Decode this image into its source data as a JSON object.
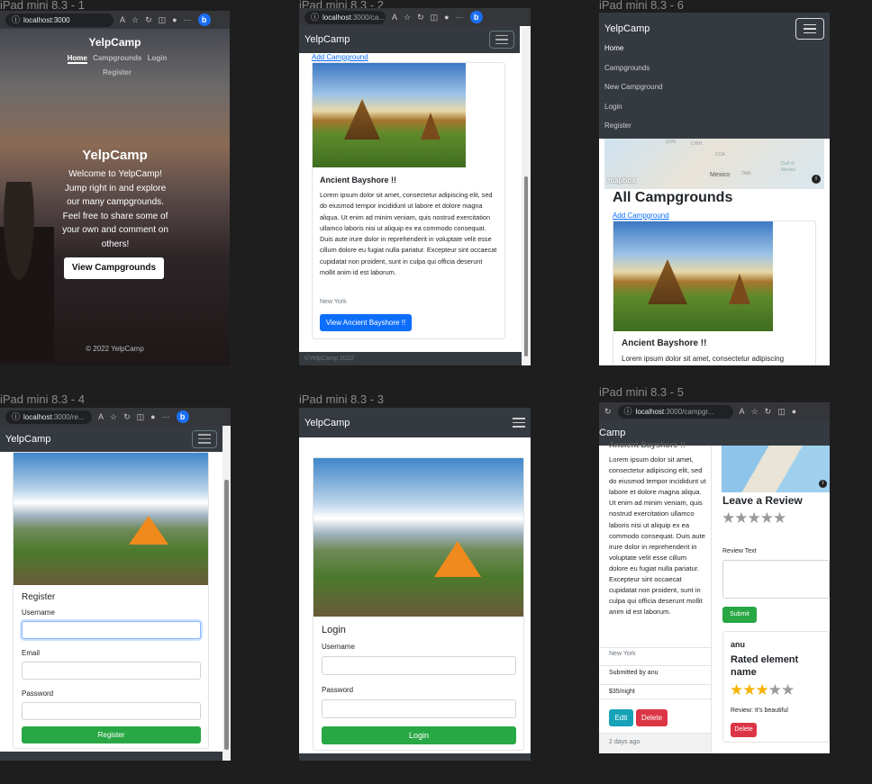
{
  "frames": [
    {
      "label": "iPad mini 8.3 - 1"
    },
    {
      "label": "iPad mini 8.3 - 2"
    },
    {
      "label": "iPad mini 8.3 - 6"
    },
    {
      "label": "iPad mini 8.3 - 4"
    },
    {
      "label": "iPad mini 8.3 - 3"
    },
    {
      "label": "iPad mini 8.3 - 5"
    }
  ],
  "browser": {
    "url_home": "localhost:3000",
    "url_campgrounds_prefix": "localhost",
    "url_campgrounds_rest": ":3000/ca...",
    "url_register_prefix": "localhost",
    "url_register_rest": ":3000/re...",
    "url_show_prefix": "localhost",
    "url_show_rest": ":3000/campgr...",
    "read_aloud": "A",
    "more": "···"
  },
  "brand": "YelpCamp",
  "brand_cut": "Camp",
  "home": {
    "nav": [
      "Home",
      "Campgrounds",
      "Login",
      "Register"
    ],
    "title": "YelpCamp",
    "lead": "Welcome to YelpCamp! Jump right in and explore our many campgrounds. Feel free to share some of your own and comment on others!",
    "cta": "View Campgrounds",
    "footer": "© 2022 YelpCamp"
  },
  "index": {
    "add_link": "Add Campground",
    "card_title": "Ancient Bayshore !!",
    "card_text": "Lorem ipsum dolor sit amet, consectetur adipiscing elit, sed do eiusmod tempor incididunt ut labore et dolore magna aliqua. Ut enim ad minim veniam, quis nostrud exercitation ullamco laboris nisi ut aliquip ex ea commodo consequat. Duis aute irure dolor in reprehenderit in voluptate velit esse cillum dolore eu fugiat nulla pariatur. Excepteur sint occaecat cupidatat non proident, sunt in culpa qui officia deserunt mollit anim id est laborum.",
    "card_text_short": "Lorem ipsum dolor sit amet, consectetur adipiscing",
    "location": "New York",
    "view_btn": "View Ancient Bayshore !!",
    "footer": "©YelpCamp 2022",
    "heading": "All Campgrounds"
  },
  "menu": [
    "Home",
    "Campgrounds",
    "New Campground",
    "Login",
    "Register"
  ],
  "map": {
    "logo": "mapbox",
    "country": "Mexico",
    "labels": [
      "SON.",
      "CHIH.",
      "COA.",
      "Gulf of Mexico",
      "TAM."
    ]
  },
  "register": {
    "title": "Register",
    "username": "Username",
    "email": "Email",
    "password": "Password",
    "submit": "Register"
  },
  "login": {
    "title": "Login",
    "username": "Username",
    "password": "Password",
    "submit": "Login"
  },
  "show": {
    "cut_title": "Ancient Bayshore !!",
    "text": "Lorem ipsum dolor sit amet, consectetur adipiscing elit, sed do eiusmod tempor incididunt ut labore et dolore magna aliqua. Ut enim ad minim veniam, quis nostrud exercitation ullamco laboris nisi ut aliquip ex ea commodo consequat. Duis aute irure dolor in reprehenderit in voluptate velit esse cillum dolore eu fugiat nulla pariatur. Excepteur sint occaecat cupidatat non proident, sunt in culpa qui officia deserunt mollit anim id est laborum.",
    "location": "New York",
    "submitted": "Submitted by anu",
    "price": "$35/night",
    "edit": "Edit",
    "delete": "Delete",
    "time": "2 days ago",
    "leave_review": "Leave a Review",
    "review_text_label": "Review Text",
    "submit": "Submit",
    "reviewer": "anu",
    "rated_label": "Rated element name",
    "review_body": "Review: It's beautiful",
    "review_delete": "Delete",
    "rating": 3,
    "rating_max": 5
  },
  "colors": {
    "navbar": "#343a40",
    "primary": "#0d6efd",
    "success": "#28a745",
    "danger": "#dc3545",
    "info": "#17a2b8",
    "star": "#f5b301",
    "star_empty": "#9a9a9a"
  }
}
